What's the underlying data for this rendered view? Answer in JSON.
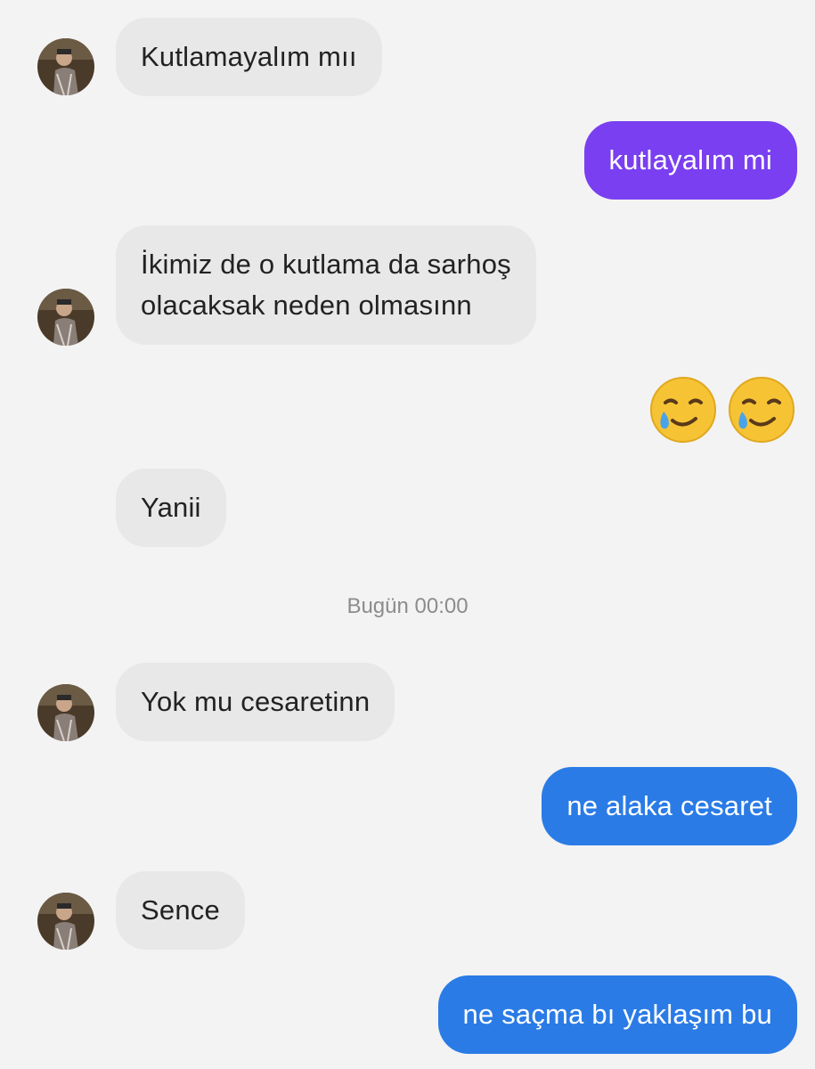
{
  "messages": [
    {
      "id": "m1",
      "sender": "them",
      "text": "Kutlamayalım mıı"
    },
    {
      "id": "m2",
      "sender": "me",
      "text": "kutlayalım mi"
    },
    {
      "id": "m3",
      "sender": "them",
      "lines": [
        "İkimiz de o kutlama da sarhoş",
        "olacaksak neden olmasınn"
      ]
    },
    {
      "id": "m4",
      "sender": "me",
      "emojis": [
        "smiling-face-with-tear-icon",
        "smiling-face-with-tear-icon"
      ]
    },
    {
      "id": "m5",
      "sender": "them",
      "text": "Yanii"
    },
    {
      "id": "m6",
      "sender": "them",
      "text": "Yok mu cesaretinn"
    },
    {
      "id": "m7",
      "sender": "me",
      "text": "ne alaka cesaret"
    },
    {
      "id": "m8",
      "sender": "them",
      "text": "Sence"
    },
    {
      "id": "m9",
      "sender": "me",
      "text": "ne saçma bı yaklaşım bu"
    }
  ],
  "divider": {
    "text": "Bugün 00:00"
  },
  "colors": {
    "incoming_bubble": "#e8e8e8",
    "incoming_text": "#222222",
    "outgoing_purple": "#7a3ff0",
    "outgoing_blue": "#2a7be6",
    "background": "#f3f3f3",
    "divider_text": "#8c8c8c"
  }
}
